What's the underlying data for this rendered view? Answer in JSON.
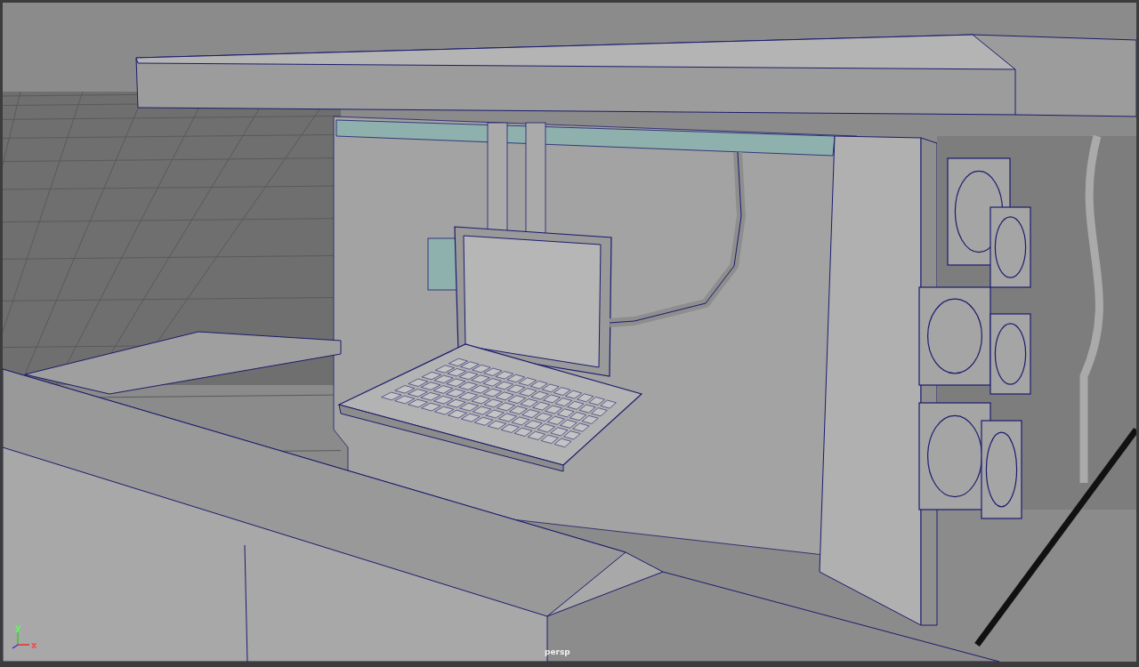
{
  "viewport": {
    "camera_label": "persp",
    "axis_labels": [
      "y",
      "x"
    ]
  }
}
